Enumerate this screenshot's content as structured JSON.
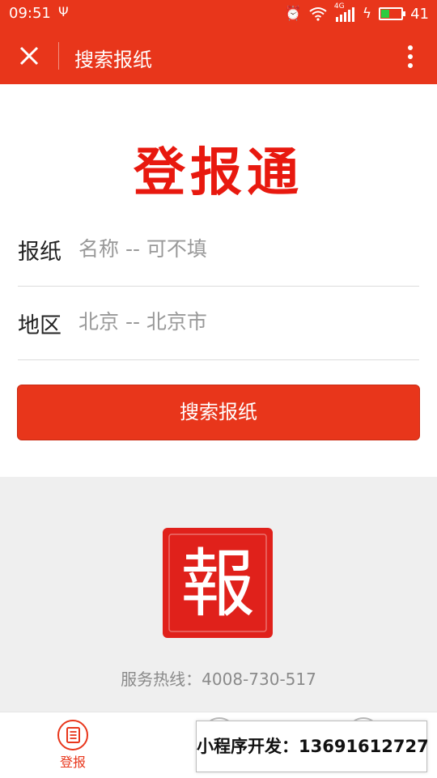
{
  "status_bar": {
    "time": "09:51",
    "network_label": "4G",
    "battery_level": "41",
    "battery_percent": 41
  },
  "nav": {
    "title": "搜索报纸",
    "close_icon": "close-icon",
    "more_icon": "more-vertical-icon"
  },
  "brand": {
    "logo_text": "登报通",
    "seal_char": "報",
    "accent_color": "#e8361b",
    "logo_color": "#e8190f"
  },
  "form": {
    "paper_label": "报纸",
    "paper_placeholder": "名称 -- 可不填",
    "region_label": "地区",
    "region_value": "北京 -- 北京市"
  },
  "search_button_label": "搜索报纸",
  "footer": {
    "hotline": "服务热线：4008-730-517"
  },
  "tabbar": {
    "home_label": "登报"
  },
  "promo": {
    "text": "小程序开发：13691612727"
  }
}
